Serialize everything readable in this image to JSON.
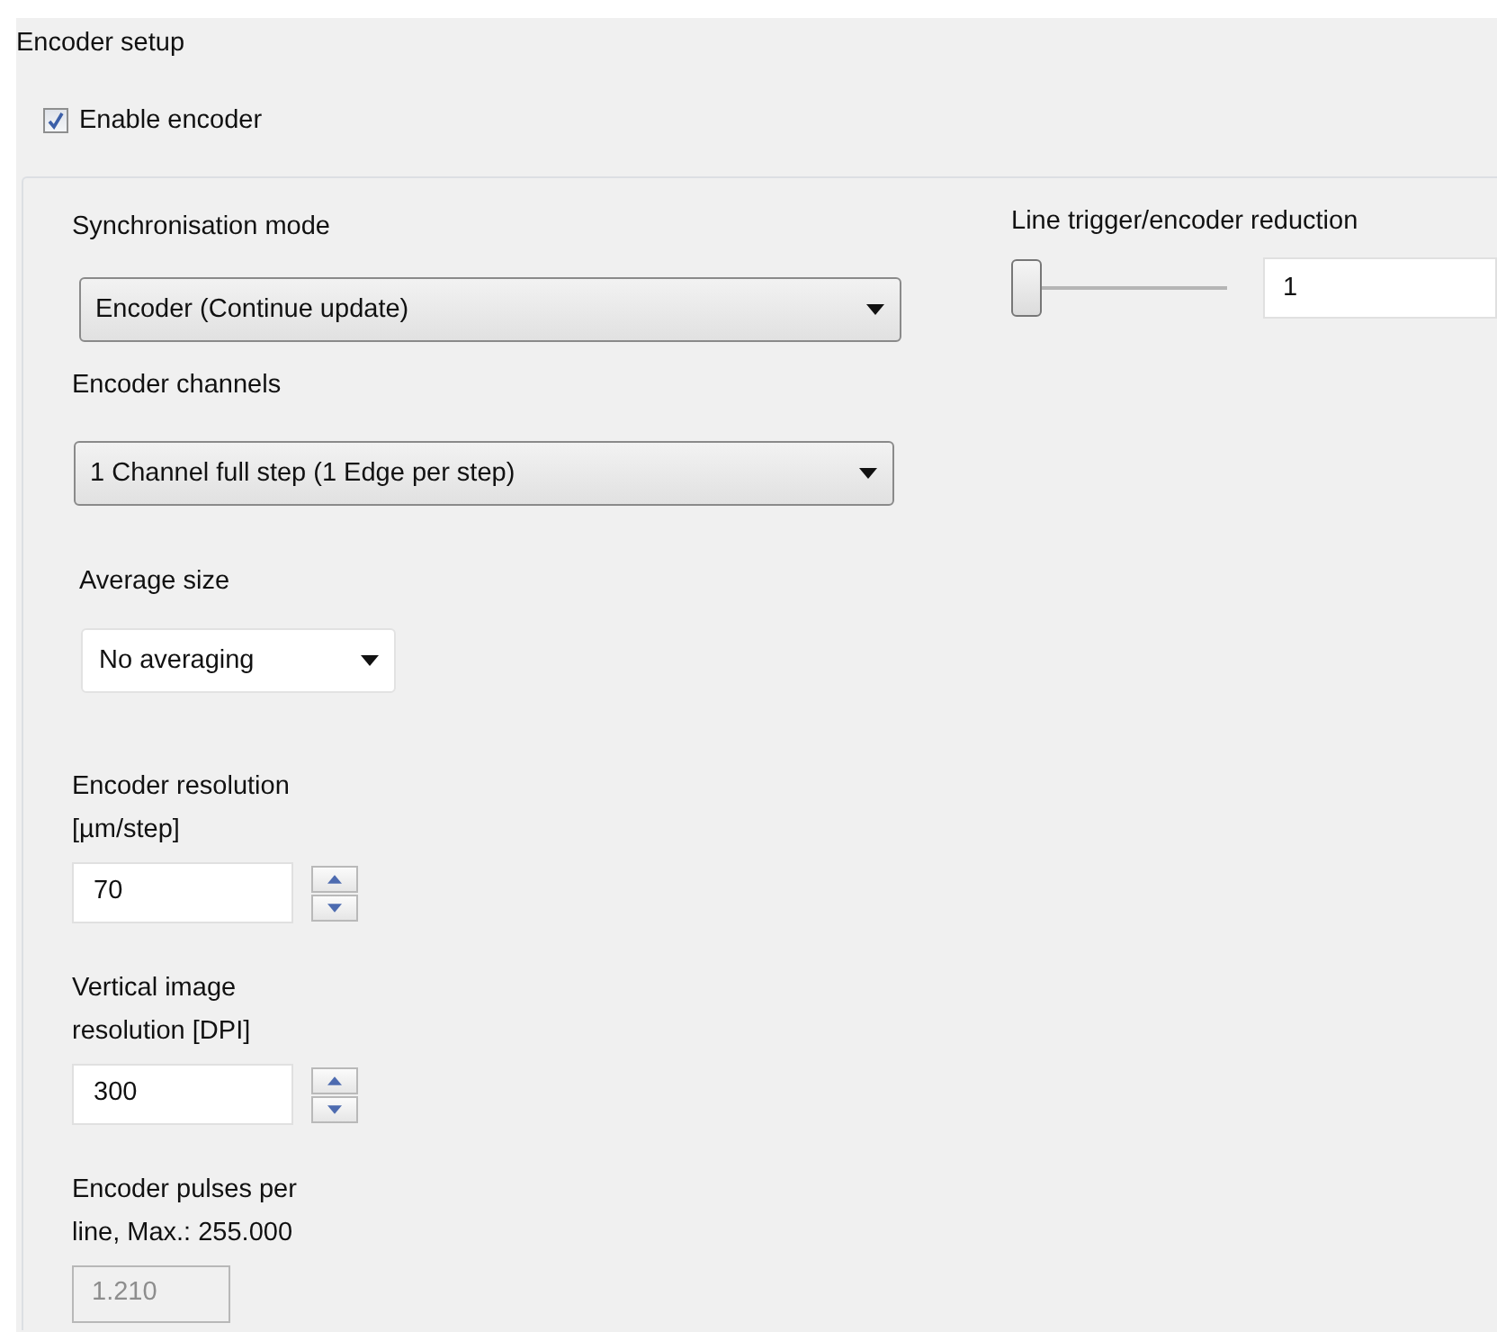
{
  "group": {
    "title": "Encoder setup"
  },
  "enable_encoder": {
    "label": "Enable encoder",
    "checked": true
  },
  "sync_mode": {
    "label": "Synchronisation mode",
    "value": "Encoder (Continue update)"
  },
  "encoder_channels": {
    "label": "Encoder channels",
    "value": "1 Channel full step (1 Edge per step)"
  },
  "average_size": {
    "label": "Average size",
    "value": "No averaging"
  },
  "reduction": {
    "label": "Line trigger/encoder reduction",
    "level": 0,
    "value": "1"
  },
  "numeric_fields": [
    {
      "kind": "spin",
      "label": "Encoder resolution [µm/step]",
      "value": "70",
      "disabled": false
    },
    {
      "kind": "spin",
      "label": "Vertical image resolution [DPI]",
      "value": "300",
      "disabled": false
    },
    {
      "kind": "plain",
      "label": "Encoder pulses per line, Max.: 255.000",
      "value": "1.210",
      "disabled": true
    }
  ]
}
